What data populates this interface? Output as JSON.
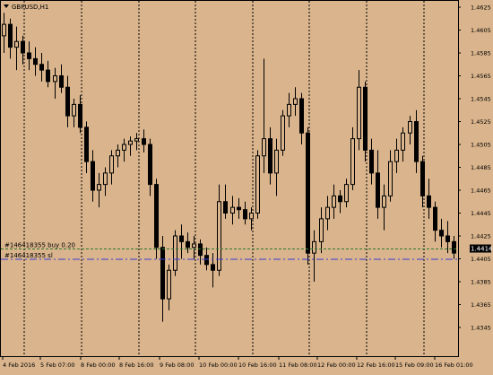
{
  "window": {
    "symbol_title": "GBPUSD,H1",
    "menu_arrow": "triangle-down-icon"
  },
  "colors": {
    "background": "#d9b48c",
    "candle": "#000000",
    "order_line": "#2f7a2f",
    "sl_line": "#3b3bd6",
    "current_price_bg": "#000000",
    "current_price_fg": "#ffffff"
  },
  "orders": {
    "buy_label": "#146418355 buy 0.20",
    "buy_price": 1.4414,
    "sl_label": "#146418355 sl",
    "sl_price": 1.4405
  },
  "current_price": "1.4414",
  "chart_data": {
    "type": "candlestick",
    "grid": "vertical dotted separators only",
    "ylim": [
      1.4335,
      1.4635
    ],
    "y_ticks": [
      "1.4625",
      "1.4605",
      "1.4585",
      "1.4565",
      "1.4545",
      "1.4525",
      "1.4505",
      "1.4485",
      "1.4465",
      "1.4445",
      "1.4425",
      "1.4405",
      "1.4385",
      "1.4365",
      "1.4345"
    ],
    "x_ticks": [
      "4 Feb 2016",
      "5 Feb 07:00",
      "8 Feb 00:00",
      "8 Feb 16:00",
      "9 Feb 08:00",
      "10 Feb 00:00",
      "10 Feb 16:00",
      "11 Feb 08:00",
      "12 Feb 00:00",
      "12 Feb 16:00",
      "15 Feb 09:00",
      "16 Feb 01:00"
    ],
    "ohlc_approx": [
      [
        1.46,
        1.462,
        1.4585,
        1.461
      ],
      [
        1.461,
        1.4615,
        1.458,
        1.459
      ],
      [
        1.459,
        1.4608,
        1.457,
        1.4595
      ],
      [
        1.4595,
        1.46,
        1.4575,
        1.4585
      ],
      [
        1.4585,
        1.4595,
        1.457,
        1.458
      ],
      [
        1.458,
        1.459,
        1.4565,
        1.4575
      ],
      [
        1.4575,
        1.4585,
        1.456,
        1.457
      ],
      [
        1.457,
        1.4578,
        1.4555,
        1.456
      ],
      [
        1.456,
        1.4572,
        1.4545,
        1.4565
      ],
      [
        1.4565,
        1.4575,
        1.455,
        1.4555
      ],
      [
        1.4555,
        1.4565,
        1.452,
        1.453
      ],
      [
        1.453,
        1.4545,
        1.452,
        1.454
      ],
      [
        1.454,
        1.4548,
        1.4515,
        1.452
      ],
      [
        1.452,
        1.4525,
        1.448,
        1.449
      ],
      [
        1.449,
        1.45,
        1.4455,
        1.4465
      ],
      [
        1.4465,
        1.448,
        1.445,
        1.447
      ],
      [
        1.447,
        1.4485,
        1.446,
        1.448
      ],
      [
        1.448,
        1.45,
        1.447,
        1.4495
      ],
      [
        1.4495,
        1.4505,
        1.4485,
        1.45
      ],
      [
        1.45,
        1.451,
        1.449,
        1.4505
      ],
      [
        1.4505,
        1.4512,
        1.4495,
        1.4508
      ],
      [
        1.4508,
        1.4515,
        1.45,
        1.451
      ],
      [
        1.451,
        1.4518,
        1.4498,
        1.4505
      ],
      [
        1.4505,
        1.451,
        1.446,
        1.447
      ],
      [
        1.447,
        1.4475,
        1.4405,
        1.4415
      ],
      [
        1.4415,
        1.4425,
        1.435,
        1.437
      ],
      [
        1.437,
        1.44,
        1.436,
        1.4395
      ],
      [
        1.4395,
        1.443,
        1.439,
        1.4425
      ],
      [
        1.4425,
        1.4435,
        1.4405,
        1.442
      ],
      [
        1.442,
        1.4428,
        1.441,
        1.4415
      ],
      [
        1.4415,
        1.4425,
        1.4405,
        1.4418
      ],
      [
        1.4418,
        1.4422,
        1.44,
        1.4408
      ],
      [
        1.4408,
        1.4415,
        1.4395,
        1.44
      ],
      [
        1.44,
        1.441,
        1.438,
        1.4395
      ],
      [
        1.4395,
        1.447,
        1.439,
        1.4455
      ],
      [
        1.4455,
        1.447,
        1.444,
        1.4445
      ],
      [
        1.4445,
        1.446,
        1.4435,
        1.445
      ],
      [
        1.445,
        1.4458,
        1.444,
        1.4448
      ],
      [
        1.4448,
        1.4455,
        1.4435,
        1.444
      ],
      [
        1.444,
        1.445,
        1.443,
        1.4445
      ],
      [
        1.4445,
        1.45,
        1.444,
        1.4495
      ],
      [
        1.4495,
        1.458,
        1.448,
        1.451
      ],
      [
        1.451,
        1.452,
        1.447,
        1.448
      ],
      [
        1.448,
        1.451,
        1.446,
        1.45
      ],
      [
        1.45,
        1.4535,
        1.4495,
        1.453
      ],
      [
        1.453,
        1.455,
        1.452,
        1.454
      ],
      [
        1.454,
        1.4555,
        1.453,
        1.4545
      ],
      [
        1.4545,
        1.455,
        1.4505,
        1.4515
      ],
      [
        1.4515,
        1.452,
        1.44,
        1.441
      ],
      [
        1.441,
        1.443,
        1.4385,
        1.442
      ],
      [
        1.442,
        1.445,
        1.441,
        1.444
      ],
      [
        1.444,
        1.446,
        1.443,
        1.445
      ],
      [
        1.445,
        1.447,
        1.444,
        1.446
      ],
      [
        1.446,
        1.4465,
        1.4445,
        1.4455
      ],
      [
        1.4455,
        1.4475,
        1.445,
        1.447
      ],
      [
        1.447,
        1.452,
        1.4465,
        1.451
      ],
      [
        1.451,
        1.457,
        1.45,
        1.4555
      ],
      [
        1.4555,
        1.456,
        1.449,
        1.45
      ],
      [
        1.45,
        1.451,
        1.447,
        1.448
      ],
      [
        1.448,
        1.45,
        1.444,
        1.445
      ],
      [
        1.445,
        1.447,
        1.443,
        1.446
      ],
      [
        1.446,
        1.45,
        1.4455,
        1.449
      ],
      [
        1.449,
        1.451,
        1.448,
        1.45
      ],
      [
        1.45,
        1.452,
        1.449,
        1.4515
      ],
      [
        1.4515,
        1.453,
        1.4505,
        1.4525
      ],
      [
        1.4525,
        1.4535,
        1.448,
        1.449
      ],
      [
        1.449,
        1.4495,
        1.445,
        1.446
      ],
      [
        1.446,
        1.4475,
        1.444,
        1.445
      ],
      [
        1.445,
        1.4455,
        1.442,
        1.443
      ],
      [
        1.443,
        1.444,
        1.4415,
        1.4425
      ],
      [
        1.4425,
        1.4438,
        1.441,
        1.442
      ],
      [
        1.442,
        1.4425,
        1.4405,
        1.441
      ]
    ]
  }
}
